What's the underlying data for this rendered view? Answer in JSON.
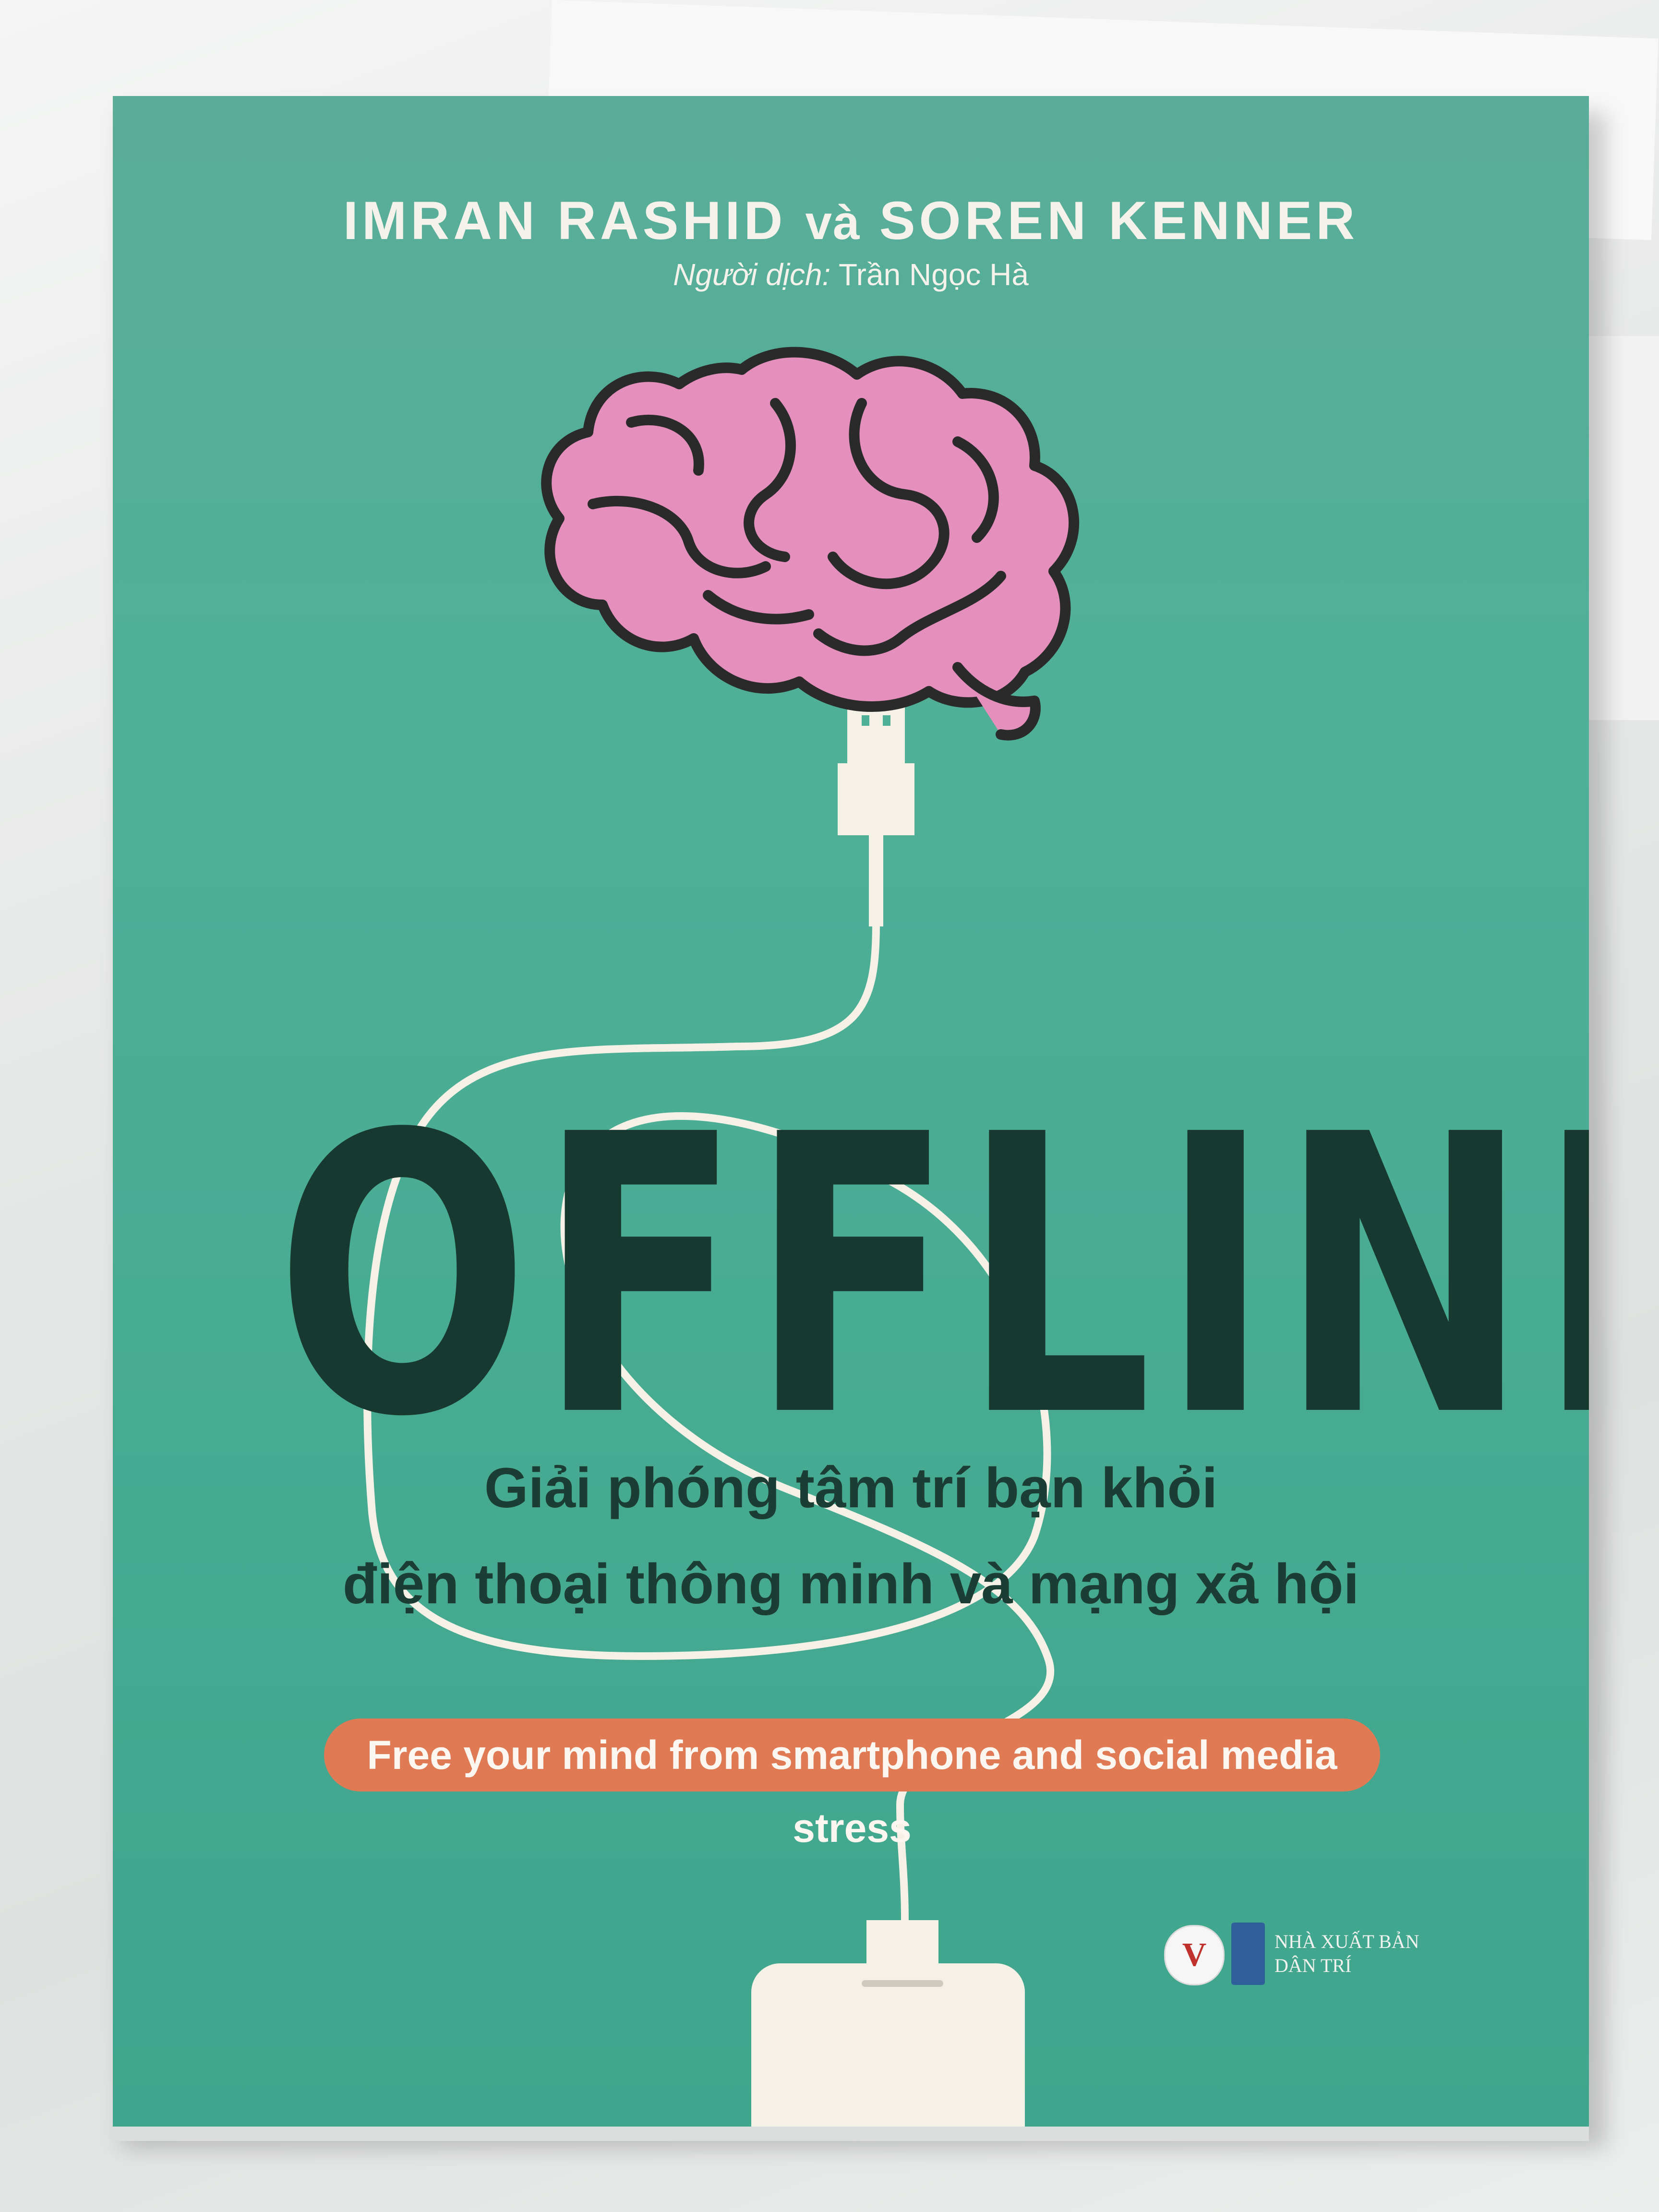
{
  "book": {
    "author_1": "IMRAN RASHID",
    "author_joiner": "và",
    "author_2": "SOREN KENNER",
    "translator_label": "Người dịch:",
    "translator_name": "Trần Ngọc Hà",
    "title": "OFFLINE",
    "subtitle_line_1": "Giải phóng tâm trí bạn khỏi",
    "subtitle_line_2": "điện thoại thông minh và mạng xã hội",
    "tagline": "Free your mind from smartphone and social media stress",
    "publisher_logo_letter": "V",
    "publisher_name_line_1": "NHÀ XUẤT BẢN",
    "publisher_name_line_2": "DÂN TRÍ"
  },
  "colors": {
    "cover_green": "#4fb097",
    "title_dark_green": "#17392f",
    "brain_pink": "#e58fbd",
    "brain_outline": "#2a2a2a",
    "tagline_orange": "#df7a55",
    "cable_white": "#f5f1e6"
  },
  "icons": [
    "brain-illustration",
    "usb-plug-icon",
    "phone-illustration",
    "publisher-logo"
  ]
}
